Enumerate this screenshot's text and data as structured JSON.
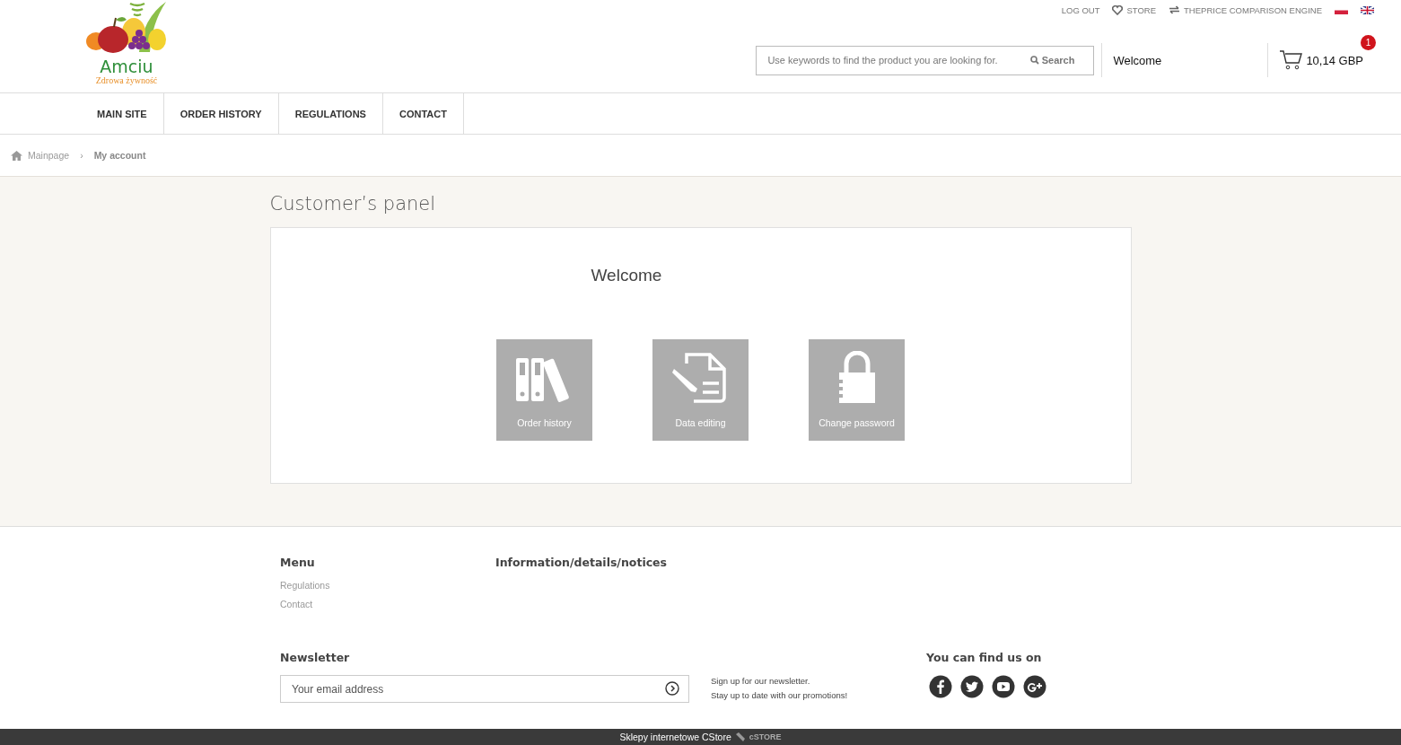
{
  "logo": {
    "name": "Amciu",
    "tagline": "Zdrowa żywność"
  },
  "top_links": [
    {
      "label": "LOG OUT",
      "kind": "plain"
    },
    {
      "label": "STORE",
      "kind": "store"
    },
    {
      "label": "THEPRICE COMPARISON ENGINE",
      "kind": "compare"
    }
  ],
  "languages": [
    {
      "kind": "pl"
    },
    {
      "kind": "uk"
    }
  ],
  "search": {
    "placeholder": "Use keywords to find the product you are looking for.",
    "button": "Search"
  },
  "welcome": "Welcome",
  "cart": {
    "total": "10,14 GBP",
    "count": "1"
  },
  "nav": [
    {
      "label": "MAIN SITE"
    },
    {
      "label": "ORDER HISTORY"
    },
    {
      "label": "REGULATIONS"
    },
    {
      "label": "CONTACT"
    }
  ],
  "breadcrumb": [
    {
      "label": "Mainpage"
    },
    {
      "label": "My account"
    }
  ],
  "breadcrumb_separator": "›",
  "page_title": "Customer’s panel",
  "panel": {
    "heading": "Welcome",
    "tiles": [
      {
        "kind": "binders",
        "label": "Order history"
      },
      {
        "kind": "document",
        "label": "Data editing"
      },
      {
        "kind": "lock",
        "label": "Change password"
      }
    ]
  },
  "footer": {
    "menu": {
      "title": "Menu",
      "links": [
        "Regulations",
        "Contact"
      ]
    },
    "info": {
      "title": "Information/details/notices"
    },
    "newsletter": {
      "title": "Newsletter",
      "placeholder": "Your email address",
      "note": [
        "Sign up for our newsletter.",
        "Stay up to date with our promotions!"
      ]
    },
    "social": {
      "title": "You can find us on",
      "icons": [
        {
          "kind": "facebook"
        },
        {
          "kind": "twitter"
        },
        {
          "kind": "youtube"
        },
        {
          "kind": "googleplus"
        }
      ]
    }
  },
  "bottom_bar": {
    "text": "Sklepy internetowe CStore",
    "logo": "cSTORE"
  }
}
